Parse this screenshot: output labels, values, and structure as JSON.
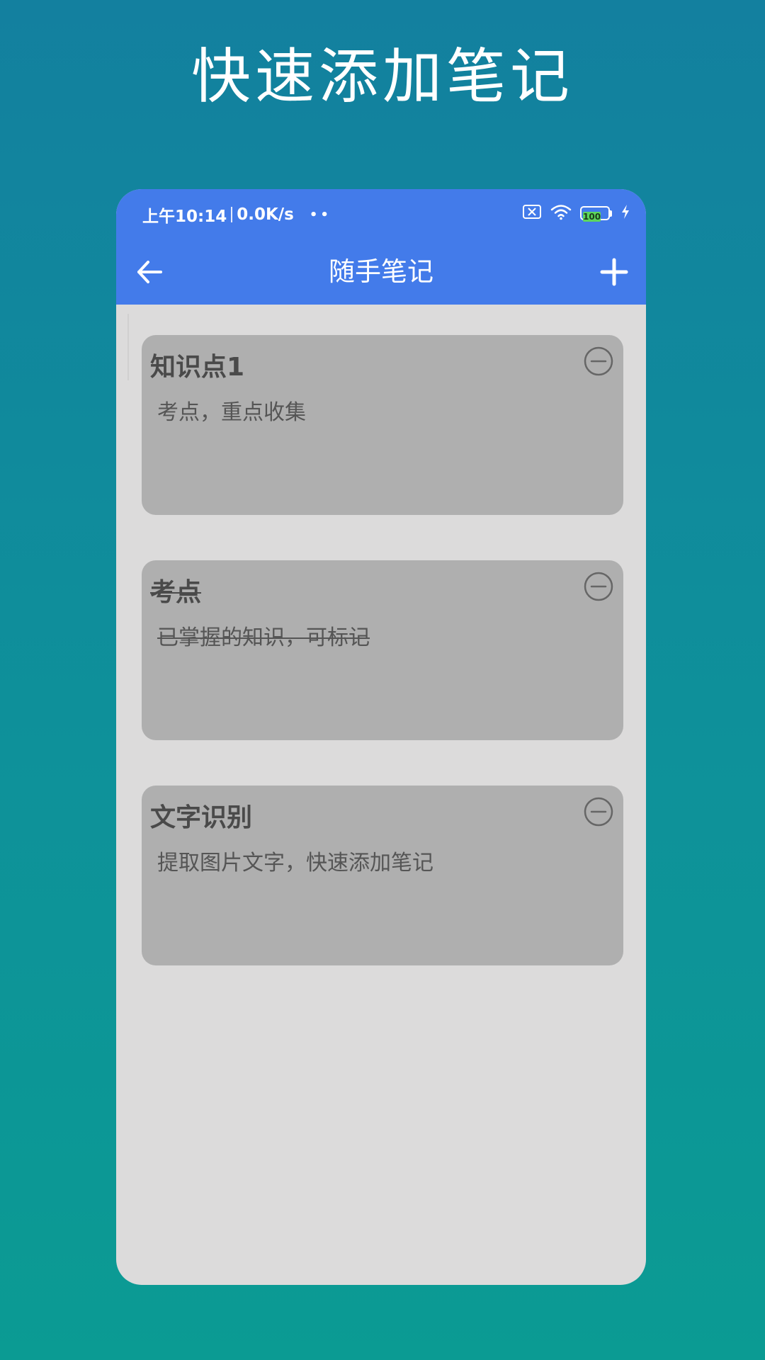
{
  "promo": {
    "title": "快速添加笔记"
  },
  "status_bar": {
    "time": "上午10:14",
    "network_speed": "0.0K/s",
    "dots": "••",
    "battery_level": "100",
    "icons": [
      "sim-no-signal-icon",
      "wifi-icon",
      "battery-icon",
      "charging-bolt-icon"
    ]
  },
  "app_bar": {
    "title": "随手笔记",
    "back_icon": "arrow-left-icon",
    "add_icon": "plus-icon"
  },
  "notes": [
    {
      "title": "知识点1",
      "body": "考点，重点收集",
      "done": false
    },
    {
      "title": "考点",
      "body": "已掌握的知识，可标记",
      "done": true
    },
    {
      "title": "文字识别",
      "body": "提取图片文字，快速添加笔记",
      "done": false
    }
  ],
  "colors": {
    "app_bar": "#437bea",
    "background_top": "#13809f",
    "background_bottom": "#0b9b93",
    "screen": "#dcdbdb",
    "card": "#afafaf"
  }
}
